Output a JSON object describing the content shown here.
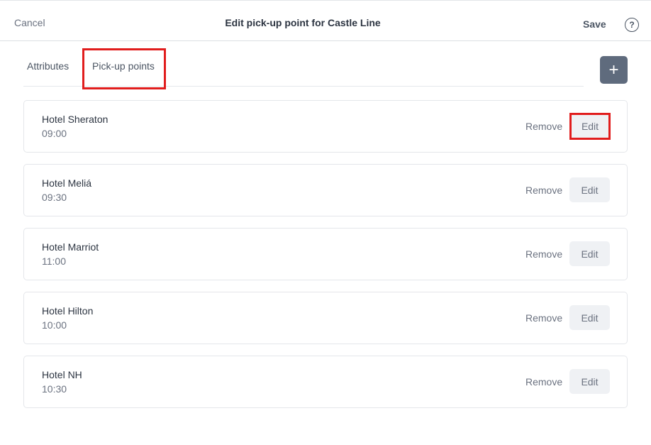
{
  "header": {
    "cancel_label": "Cancel",
    "title": "Edit pick-up point for Castle Line",
    "save_label": "Save",
    "help_glyph": "?"
  },
  "tabs": [
    {
      "label": "Attributes",
      "active": false
    },
    {
      "label": "Pick-up points",
      "active": true
    }
  ],
  "add_glyph": "+",
  "pickup_points": [
    {
      "name": "Hotel Sheraton",
      "time": "09:00",
      "remove_label": "Remove",
      "edit_label": "Edit"
    },
    {
      "name": "Hotel Meliá",
      "time": "09:30",
      "remove_label": "Remove",
      "edit_label": "Edit"
    },
    {
      "name": "Hotel Marriot",
      "time": "11:00",
      "remove_label": "Remove",
      "edit_label": "Edit"
    },
    {
      "name": "Hotel Hilton",
      "time": "10:00",
      "remove_label": "Remove",
      "edit_label": "Edit"
    },
    {
      "name": "Hotel NH",
      "time": "10:30",
      "remove_label": "Remove",
      "edit_label": "Edit"
    }
  ],
  "colors": {
    "accent_highlight": "#e11d1d",
    "add_button_bg": "#5f6b7d",
    "edit_button_bg": "#eff1f4"
  },
  "icons": {
    "help": "question-circle-icon",
    "add": "plus-icon"
  }
}
